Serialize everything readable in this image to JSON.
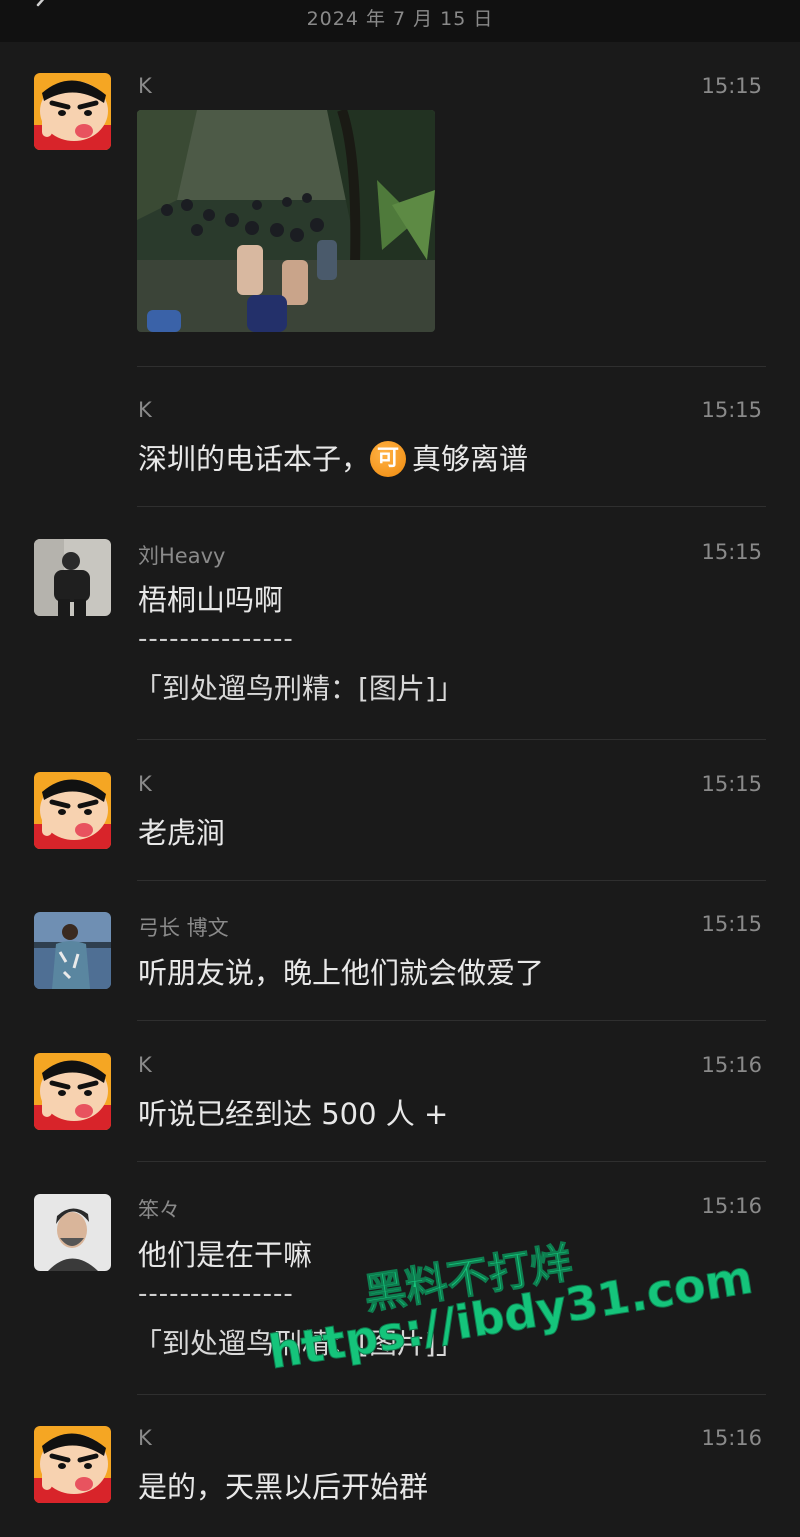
{
  "header": {
    "date": "2024 年 7 月 15 日"
  },
  "messages": [
    {
      "name": "K",
      "time": "15:15"
    },
    {
      "name": "K",
      "time": "15:15",
      "text_before": "深圳的电话本子，",
      "emoji": "可",
      "text_after": "真够离谱"
    },
    {
      "name": "刘Heavy",
      "time": "15:15",
      "text": "梧桐山吗啊",
      "dash": "---------------",
      "quote": "「到处遛鸟刑精：[图片]」"
    },
    {
      "name": "K",
      "time": "15:15",
      "text": "老虎涧"
    },
    {
      "name": "弓长 博文",
      "time": "15:15",
      "text": "听朋友说，晚上他们就会做爱了"
    },
    {
      "name": "K",
      "time": "15:16",
      "text": "听说已经到达 500 人 +"
    },
    {
      "name": "笨々",
      "time": "15:16",
      "text": "他们是在干嘛",
      "dash": "---------------",
      "quote": "「到处遛鸟刑精：[图片]」"
    },
    {
      "name": "K",
      "time": "15:16",
      "text": "是的，天黑以后开始群"
    }
  ],
  "watermark": {
    "line1": "黑料不打烊",
    "line2": "https://ibdy31.com"
  },
  "colors": {
    "background": "#1a1a1a",
    "text": "#e8e8e8",
    "meta": "#8a8a8a",
    "watermark": "#15c47b"
  }
}
